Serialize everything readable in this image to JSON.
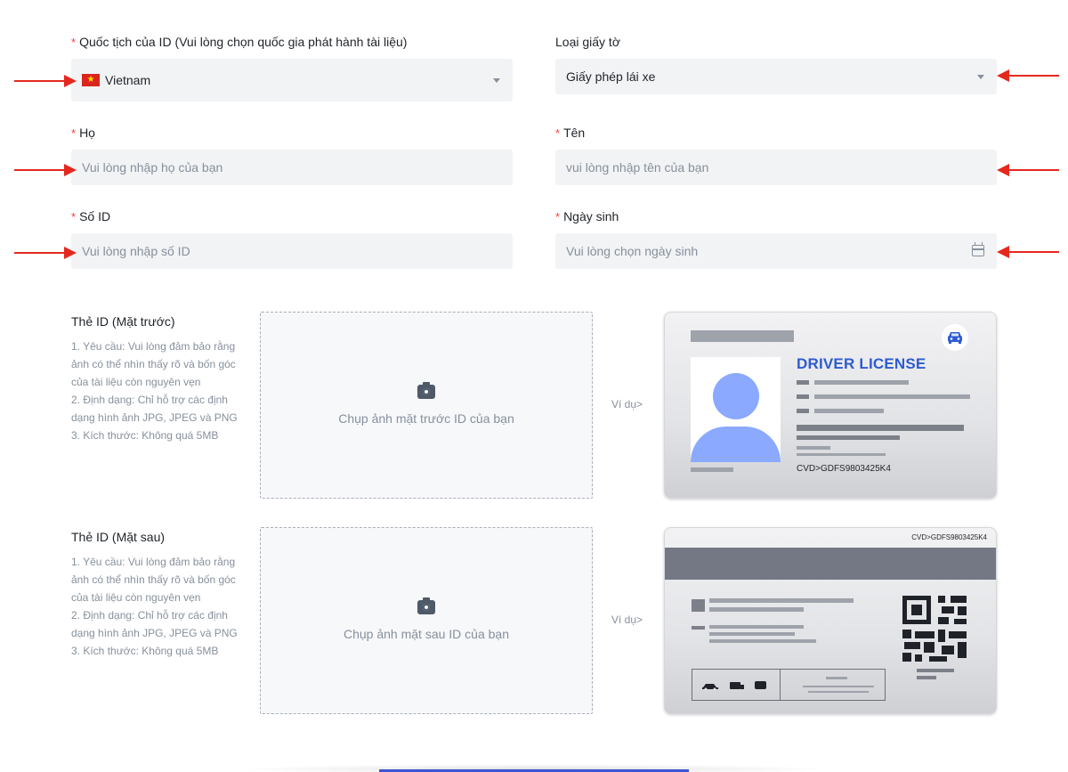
{
  "fields": {
    "nationality": {
      "label": "Quốc tịch của ID (Vui lòng chọn quốc gia phát hành tài liệu)",
      "value": "Vietnam",
      "required": "*"
    },
    "doc_type": {
      "label": "Loại giấy tờ",
      "value": "Giấy phép lái xe"
    },
    "last_name": {
      "label": "Họ",
      "placeholder": "Vui lòng nhập họ của bạn",
      "required": "*"
    },
    "first_name": {
      "label": "Tên",
      "placeholder": "vui lòng nhập tên của bạn",
      "required": "*"
    },
    "id_number": {
      "label": "Số ID",
      "placeholder": "Vui lòng nhập số ID",
      "required": "*"
    },
    "birth_date": {
      "label": "Ngày sinh",
      "placeholder": "Vui lòng chọn ngày sinh",
      "required": "*"
    }
  },
  "front": {
    "title": "Thẻ ID (Mặt trước)",
    "requirements": [
      "1. Yêu cầu: Vui lòng đảm bảo rằng ảnh có thể nhìn thấy rõ và bốn góc của tài liệu còn nguyên vẹn",
      "2. Định dạng: Chỉ hỗ trợ các định dạng hình ảnh JPG, JPEG và PNG",
      "3. Kích thước: Không quá 5MB"
    ],
    "upload_text": "Chụp ảnh mặt trước ID của bạn",
    "example_label": "Ví dụ>",
    "card_title": "DRIVER LICENSE",
    "card_code": "CVD>GDFS9803425K4"
  },
  "back": {
    "title": "Thẻ ID (Mặt sau)",
    "requirements": [
      "1. Yêu cầu: Vui lòng đảm bảo rằng ảnh có thể nhìn thấy rõ và bốn góc của tài liệu còn nguyên vẹn",
      "2. Định dạng: Chỉ hỗ trợ các định dạng hình ảnh JPG, JPEG và PNG",
      "3. Kích thước: Không quá 5MB"
    ],
    "upload_text": "Chụp ảnh mặt sau ID của bạn",
    "example_label": "Ví dụ>",
    "card_code": "CVD>GDFS9803425K4"
  },
  "colors": {
    "required": "#f53f3f",
    "arrow": "#e5281e",
    "card_title": "#2d5bd1",
    "submit": "#3c55d6"
  },
  "icons": {
    "flag": "vietnam-flag-icon",
    "camera": "camera-icon",
    "calendar": "calendar-icon",
    "car": "car-icon"
  }
}
